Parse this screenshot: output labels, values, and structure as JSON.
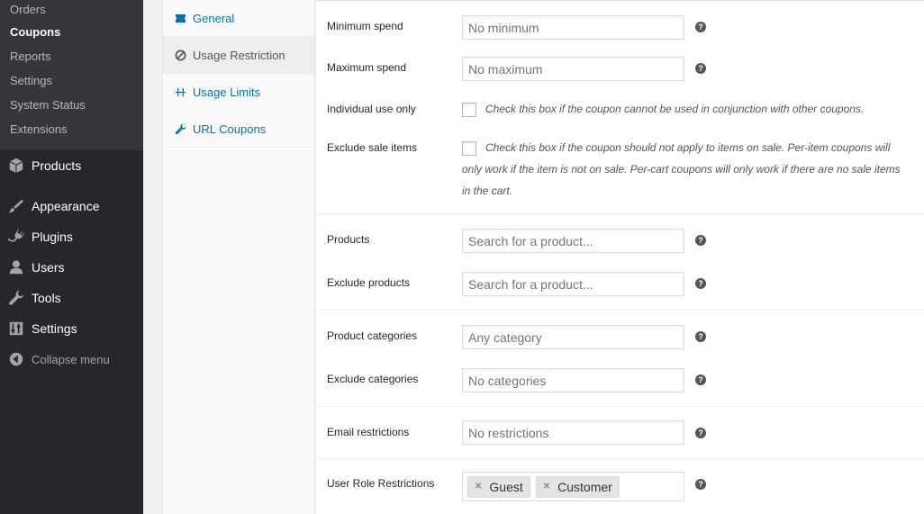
{
  "sidebar": {
    "submenu": [
      "Orders",
      "Coupons",
      "Reports",
      "Settings",
      "System Status",
      "Extensions"
    ],
    "current_submenu": "Coupons",
    "menu": {
      "products": "Products",
      "appearance": "Appearance",
      "plugins": "Plugins",
      "users": "Users",
      "tools": "Tools",
      "settings": "Settings",
      "collapse": "Collapse menu"
    }
  },
  "tabs": {
    "general": "General",
    "usage_restriction": "Usage Restriction",
    "usage_limits": "Usage Limits",
    "url_coupons": "URL Coupons"
  },
  "fields": {
    "minimum_spend": {
      "label": "Minimum spend",
      "placeholder": "No minimum"
    },
    "maximum_spend": {
      "label": "Maximum spend",
      "placeholder": "No maximum"
    },
    "individual_use": {
      "label": "Individual use only",
      "description": "Check this box if the coupon cannot be used in conjunction with other coupons."
    },
    "exclude_sale": {
      "label": "Exclude sale items",
      "description": "Check this box if the coupon should not apply to items on sale. Per-item coupons will only work if the item is not on sale. Per-cart coupons will only work if there are no sale items in the cart."
    },
    "products": {
      "label": "Products",
      "placeholder": "Search for a product..."
    },
    "exclude_products": {
      "label": "Exclude products",
      "placeholder": "Search for a product..."
    },
    "product_categories": {
      "label": "Product categories",
      "placeholder": "Any category"
    },
    "exclude_categories": {
      "label": "Exclude categories",
      "placeholder": "No categories"
    },
    "email_restrictions": {
      "label": "Email restrictions",
      "placeholder": "No restrictions"
    },
    "user_roles": {
      "label": "User Role Restrictions",
      "tags": [
        "Guest",
        "Customer"
      ]
    }
  },
  "help_glyph": "?",
  "tag_remove_glyph": "✕",
  "colors": {
    "sidebar_bg": "#23282d",
    "submenu_bg": "#32373c",
    "link": "#0073aa"
  }
}
